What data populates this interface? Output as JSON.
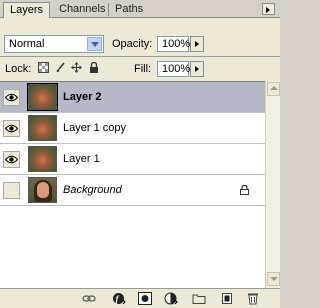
{
  "tabs": [
    {
      "label": "Layers",
      "active": true
    },
    {
      "label": "Channels",
      "active": false
    },
    {
      "label": "Paths",
      "active": false
    }
  ],
  "blend_mode": {
    "selected": "Normal"
  },
  "opacity": {
    "label": "Opacity:",
    "value": "100%"
  },
  "lock": {
    "label": "Lock:",
    "icons": [
      "lock-transparent-icon",
      "lock-brush-icon",
      "lock-move-icon",
      "lock-all-icon"
    ]
  },
  "fill": {
    "label": "Fill:",
    "value": "100%"
  },
  "layers": [
    {
      "name": "Layer 2",
      "visible": true,
      "selected": true
    },
    {
      "name": "Layer 1 copy",
      "visible": true,
      "selected": false
    },
    {
      "name": "Layer 1",
      "visible": true,
      "selected": false
    },
    {
      "name": "Background",
      "visible": false,
      "selected": false,
      "locked": true
    }
  ],
  "bottom_icons": [
    "link-layers-icon",
    "layer-style-icon",
    "layer-mask-icon",
    "adjustment-layer-icon",
    "new-group-icon",
    "new-layer-icon",
    "delete-layer-icon"
  ],
  "colors": {
    "selected_row": "#b6b8c6",
    "panel_bg": "#ece9d8"
  }
}
